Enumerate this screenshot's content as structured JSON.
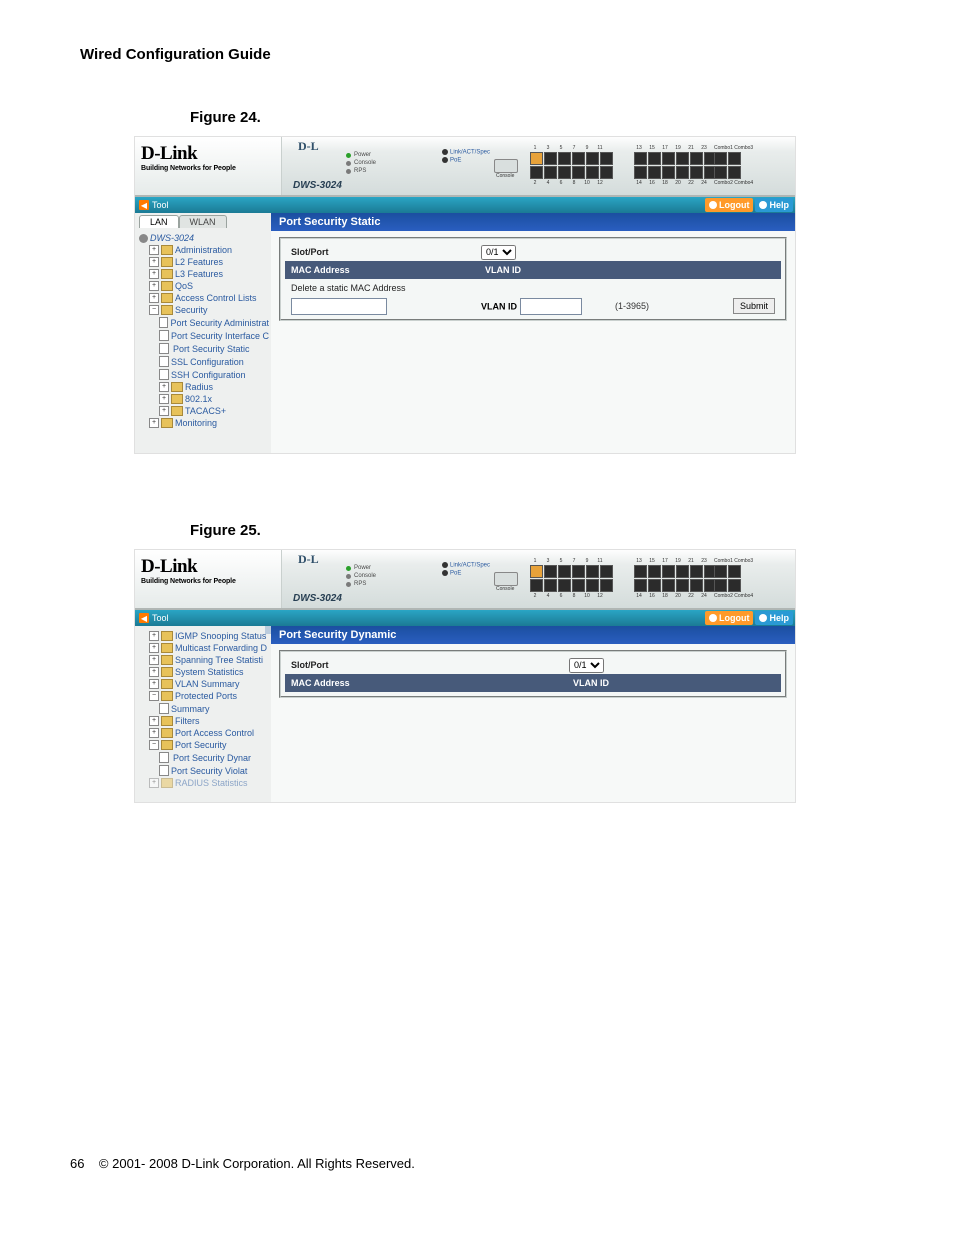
{
  "doc": {
    "title": "Wired Configuration Guide",
    "fig24": "Figure 24.",
    "fig25": "Figure 25.",
    "footer_page": "66",
    "footer_text": "© 2001- 2008 D-Link Corporation. All Rights Reserved."
  },
  "brand": {
    "logo": "D-Link",
    "tag": "Building Networks for People",
    "dev_prefix": "D-L",
    "model": "DWS-3024"
  },
  "leds": {
    "power": "Power",
    "console": "Console",
    "rps": "RPS",
    "act": "Link/ACT/Spec",
    "poe": "PoE"
  },
  "device": {
    "ports_top_a": [
      "1",
      "3",
      "5",
      "7",
      "9",
      "11"
    ],
    "ports_bot_a": [
      "2",
      "4",
      "6",
      "8",
      "10",
      "12"
    ],
    "ports_top_b": [
      "13",
      "15",
      "17",
      "19",
      "21",
      "23"
    ],
    "ports_bot_b": [
      "14",
      "16",
      "18",
      "20",
      "22",
      "24"
    ],
    "combo1": "Combo1 Combo3",
    "combo2": "Combo2 Combo4",
    "console": "Console"
  },
  "toolbar": {
    "tool": "Tool",
    "logout": "Logout",
    "help": "Help"
  },
  "fig24": {
    "tabs": {
      "lan": "LAN",
      "wlan": "WLAN"
    },
    "tree": {
      "root": "DWS-3024",
      "items": [
        "Administration",
        "L2 Features",
        "L3 Features",
        "QoS",
        "Access Control Lists",
        "Security"
      ],
      "sec_children": [
        "Port Security Administrat",
        "Port Security Interface C",
        "Port Security Static",
        "SSL Configuration",
        "SSH Configuration",
        "Radius",
        "802.1x",
        "TACACS+"
      ],
      "last": "Monitoring"
    },
    "panel": {
      "title": "Port Security Static",
      "slotport_label": "Slot/Port",
      "slotport_value": "0/1",
      "mac_label": "MAC Address",
      "vlan_label": "VLAN ID",
      "delete_label": "Delete a static MAC Address",
      "vlan_label2": "VLAN ID",
      "vlan_range": "(1-3965)",
      "submit": "Submit"
    }
  },
  "fig25": {
    "tree": {
      "items": [
        "IGMP Snooping Status",
        "Multicast Forwarding D",
        "Spanning Tree Statisti",
        "System Statistics",
        "VLAN Summary",
        "Protected Ports"
      ],
      "pp_child": "Summary",
      "items2": [
        "Filters",
        "Port Access Control",
        "Port Security"
      ],
      "ps_children": [
        "Port Security Dynar",
        "Port Security Violat"
      ],
      "trailing": "RADIUS Statistics"
    },
    "panel": {
      "title": "Port Security Dynamic",
      "slotport_label": "Slot/Port",
      "slotport_value": "0/1",
      "mac_label": "MAC Address",
      "vlan_label": "VLAN ID"
    }
  }
}
